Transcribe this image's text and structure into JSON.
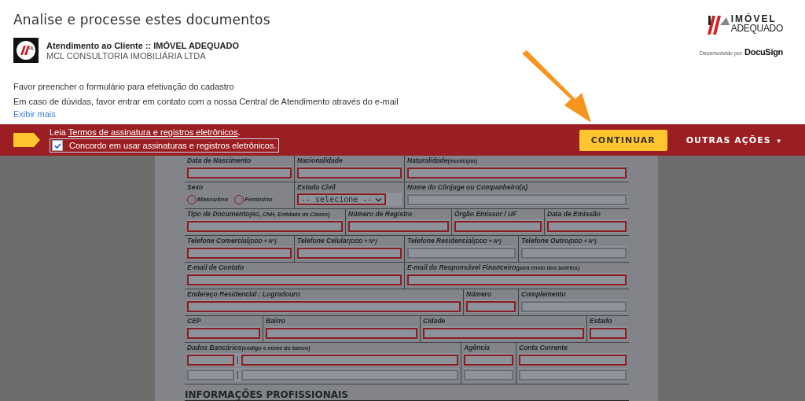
{
  "header": {
    "title": "Analise e processe estes documentos",
    "sender": {
      "name": "Atendimento ao Cliente :: IMÓVEL ADEQUADO",
      "company": "MCL CONSULTORIA IMOBILIÁRIA LTDA"
    },
    "brand": {
      "line1": "IMÓVEL",
      "line2": "ADEQUADO",
      "powered_label": "Desenvolvido por",
      "powered_brand": "DocuSign"
    },
    "messages": [
      "Favor preencher o formulário para efetivação do cadastro",
      "Em caso de dúvidas, favor entrar em contato com a nossa Central de Atendimento através do e-mail"
    ],
    "show_more": "Exibir mais"
  },
  "action_bar": {
    "terms_prefix": "Leia",
    "terms_link": "Termos de assinatura e registros eletrônicos",
    "terms_suffix": ".",
    "consent": {
      "label": "Concordo em usar assinaturas e registros eletrônicos.",
      "checked": true
    },
    "continue_button": "CONTINUAR",
    "other_actions": "OUTRAS AÇÕES",
    "other_actions_caret": "▾"
  },
  "form": {
    "rows": [
      {
        "cells": [
          {
            "kind": "input",
            "label": "Data de Nascimento",
            "lines": [
              {
                "fields": [
                  {
                    "required": true
                  }
                ]
              }
            ]
          },
          {
            "kind": "input",
            "label": "Nacionalidade",
            "lines": [
              {
                "fields": [
                  {
                    "required": true
                  }
                ]
              }
            ]
          },
          {
            "kind": "input",
            "label": "Naturalidade",
            "hint": "(município)",
            "lines": [
              {
                "fields": [
                  {
                    "required": true
                  }
                ]
              }
            ]
          }
        ]
      },
      {
        "cells": [
          {
            "kind": "radio",
            "label": "Sexo",
            "options": [
              {
                "label": "Masculino",
                "selected": false
              },
              {
                "label": "Feminino",
                "selected": false
              }
            ]
          },
          {
            "kind": "select",
            "label": "Estado Civil",
            "value": "-- selecione --",
            "required": true
          },
          {
            "kind": "input",
            "label": "Nome do Cônjuge ou Companheiro(a)",
            "lines": [
              {
                "fields": [
                  {
                    "required": false
                  }
                ]
              }
            ]
          }
        ]
      },
      {
        "cells": [
          {
            "kind": "input",
            "label": "Tipo de Documento",
            "hint": "(RG, CNH, Entidade de Classe)",
            "lines": [
              {
                "fields": [
                  {
                    "required": true
                  }
                ]
              }
            ]
          },
          {
            "kind": "input",
            "label": "Número de Registro",
            "lines": [
              {
                "fields": [
                  {
                    "required": true
                  }
                ]
              }
            ]
          },
          {
            "kind": "input",
            "label": "Órgão Emissor / UF",
            "lines": [
              {
                "fields": [
                  {
                    "required": true
                  }
                ]
              }
            ]
          },
          {
            "kind": "input",
            "label": "Data de Emissão",
            "lines": [
              {
                "fields": [
                  {
                    "required": true
                  }
                ]
              }
            ]
          }
        ]
      },
      {
        "cells": [
          {
            "kind": "input",
            "label": "Telefone Comercial",
            "hint": "(DDD + Nº)",
            "lines": [
              {
                "fields": [
                  {
                    "required": true
                  }
                ]
              }
            ]
          },
          {
            "kind": "input",
            "label": "Telefone Celular",
            "hint": "(DDD + Nº)",
            "lines": [
              {
                "fields": [
                  {
                    "required": true
                  }
                ]
              }
            ]
          },
          {
            "kind": "input",
            "label": "Telefone Residencial",
            "hint": "(DDD + Nº)",
            "lines": [
              {
                "fields": [
                  {
                    "required": false
                  }
                ]
              }
            ]
          },
          {
            "kind": "input",
            "label": "Telefone Outro",
            "hint": "(DDD + Nº)",
            "lines": [
              {
                "fields": [
                  {
                    "required": false
                  }
                ]
              }
            ]
          }
        ]
      },
      {
        "cells": [
          {
            "kind": "input",
            "label": "E-mail de Contato",
            "lines": [
              {
                "fields": [
                  {
                    "required": true
                  }
                ]
              }
            ]
          },
          {
            "kind": "input",
            "label": "E-mail do Responsável Financeiro",
            "hint": "(para envio dos boletos)",
            "lines": [
              {
                "fields": [
                  {
                    "required": true
                  }
                ]
              }
            ]
          }
        ]
      },
      {
        "cells": [
          {
            "kind": "input",
            "label": "Endereço Residencial : Logradouro",
            "lines": [
              {
                "fields": [
                  {
                    "required": true
                  }
                ]
              }
            ]
          },
          {
            "kind": "input",
            "label": "Número",
            "lines": [
              {
                "fields": [
                  {
                    "required": true
                  }
                ]
              }
            ]
          },
          {
            "kind": "input",
            "label": "Complemento",
            "lines": [
              {
                "fields": [
                  {
                    "required": false
                  }
                ]
              }
            ]
          }
        ]
      },
      {
        "cells": [
          {
            "kind": "input",
            "label": "CEP",
            "lines": [
              {
                "fields": [
                  {
                    "required": true
                  }
                ]
              }
            ]
          },
          {
            "kind": "input",
            "label": "Bairro",
            "lines": [
              {
                "fields": [
                  {
                    "required": true
                  }
                ]
              }
            ]
          },
          {
            "kind": "input",
            "label": "Cidade",
            "lines": [
              {
                "fields": [
                  {
                    "required": true
                  }
                ]
              }
            ]
          },
          {
            "kind": "input",
            "label": "Estado",
            "lines": [
              {
                "fields": [
                  {
                    "required": true
                  }
                ]
              }
            ]
          }
        ]
      },
      {
        "cells": [
          {
            "kind": "input",
            "label": "Dados Bancários",
            "hint": "(código e nome do banco)",
            "separator": "|",
            "lines": [
              {
                "fields": [
                  {
                    "required": true
                  },
                  {
                    "required": true
                  }
                ]
              },
              {
                "fields": [
                  {
                    "required": false
                  },
                  {
                    "required": false
                  }
                ]
              }
            ]
          },
          {
            "kind": "input",
            "label": "Agência",
            "lines": [
              {
                "fields": [
                  {
                    "required": true
                  }
                ]
              },
              {
                "fields": [
                  {
                    "required": false
                  }
                ]
              }
            ]
          },
          {
            "kind": "input",
            "label": "Conta Corrente",
            "lines": [
              {
                "fields": [
                  {
                    "required": true
                  }
                ]
              },
              {
                "fields": [
                  {
                    "required": false
                  }
                ]
              }
            ]
          }
        ]
      }
    ],
    "section_heading": "INFORMAÇÕES PROFISSIONAIS"
  }
}
